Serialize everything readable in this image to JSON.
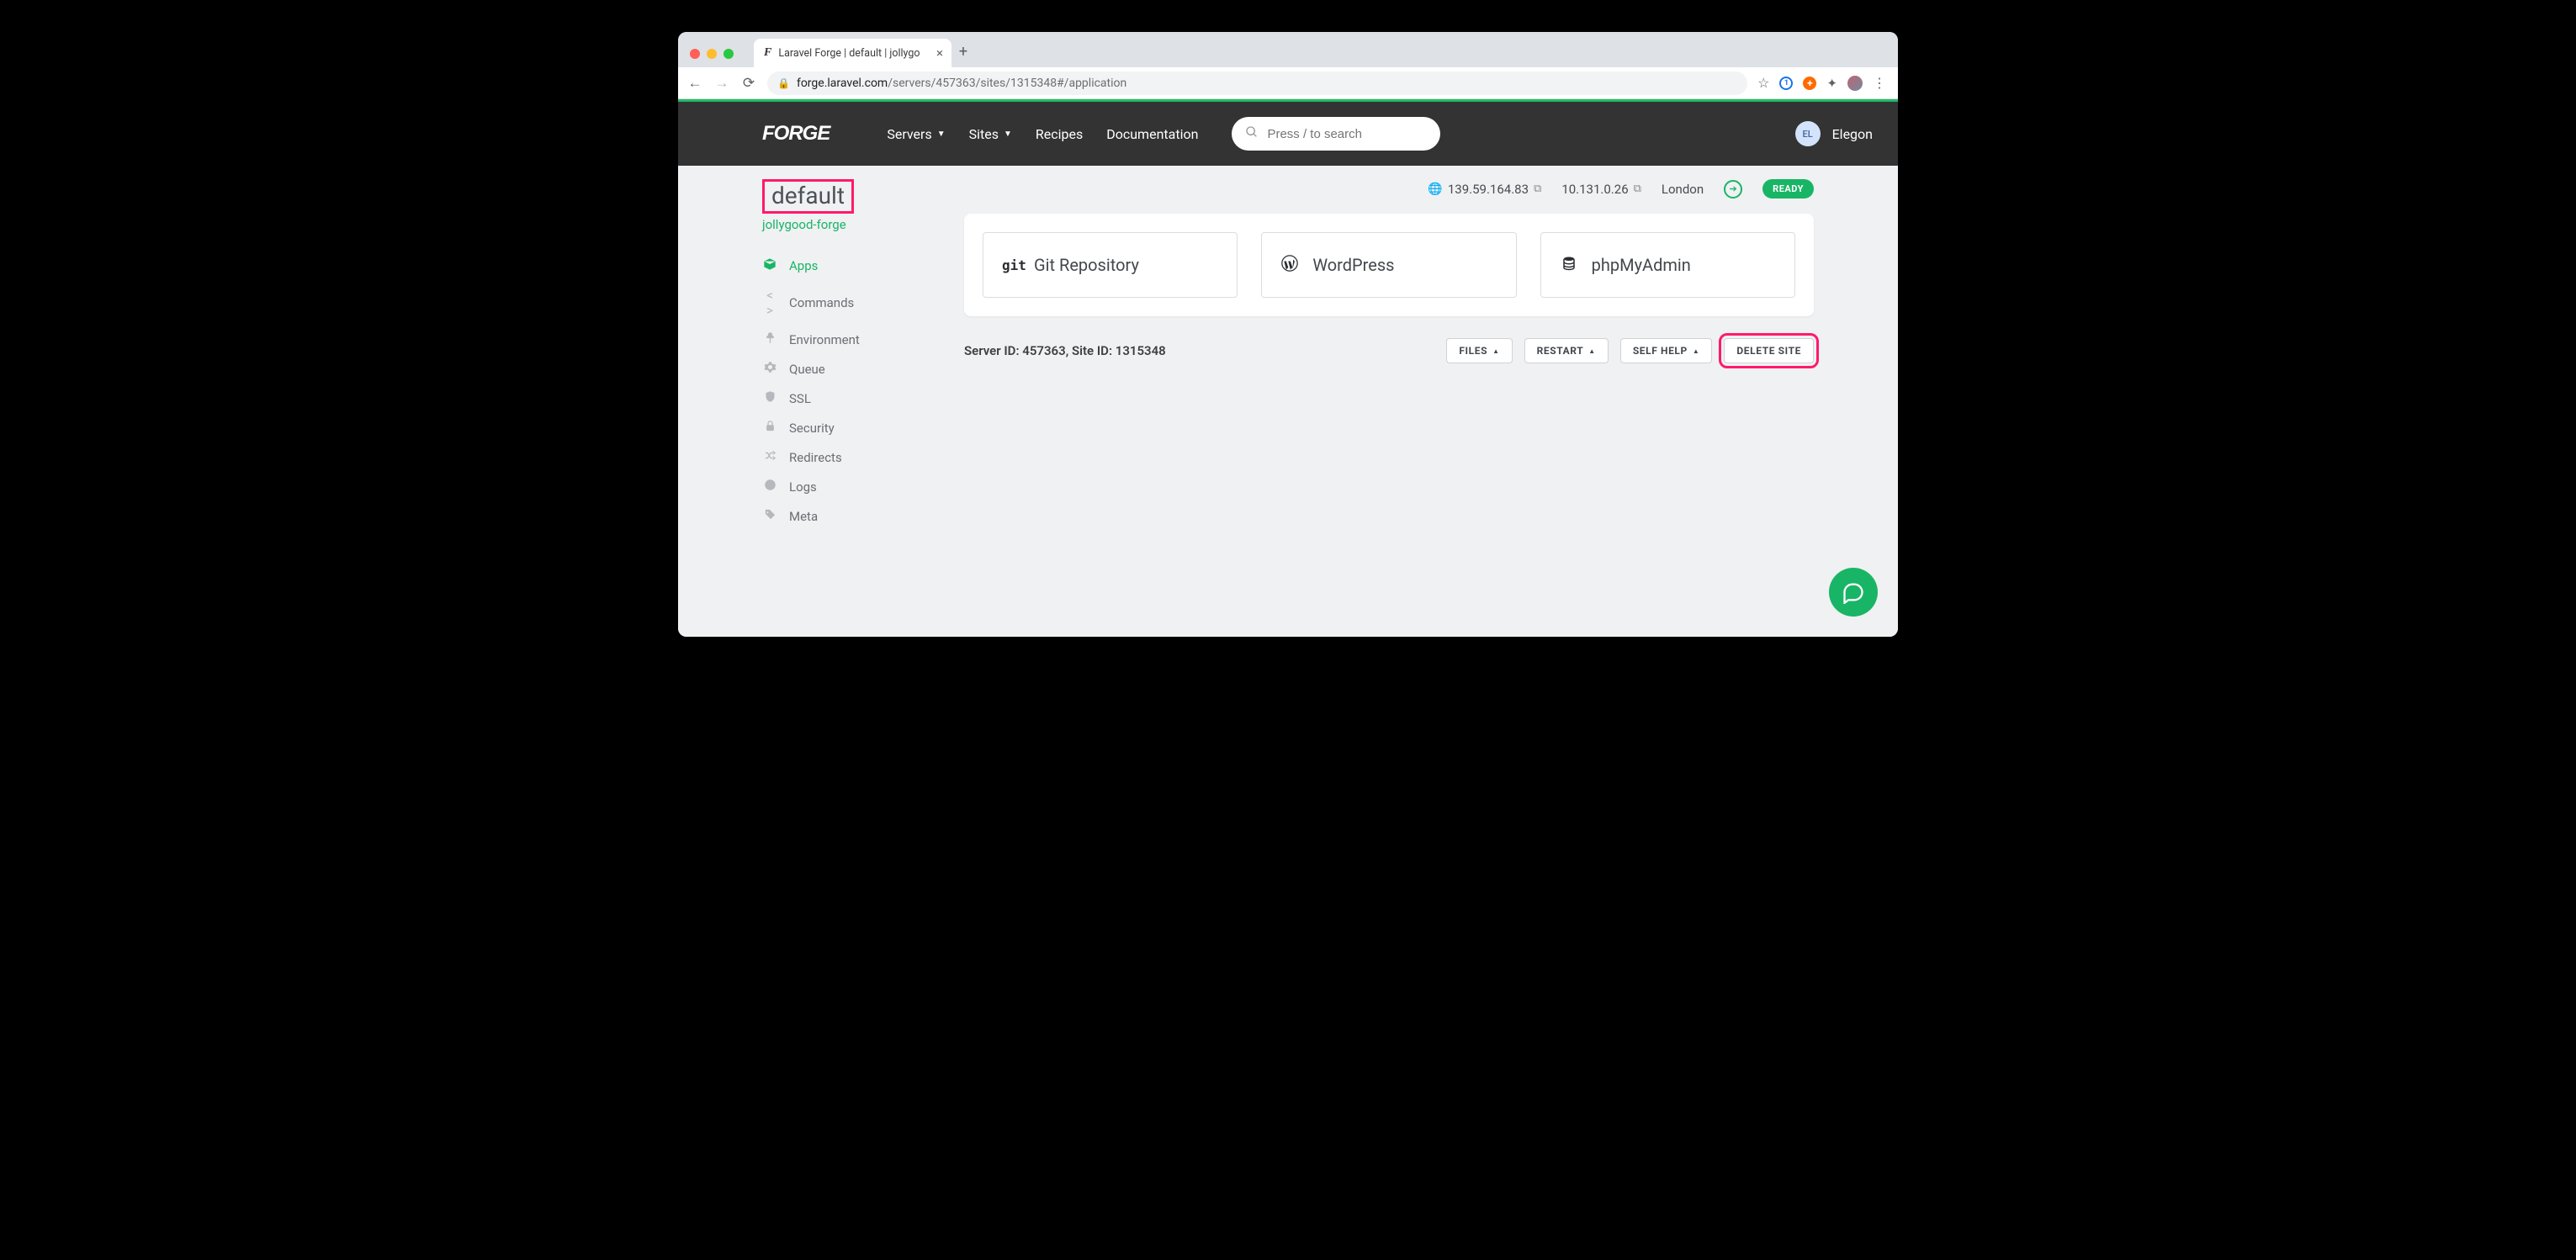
{
  "browser": {
    "tab_title": "Laravel Forge | default | jollygo",
    "url_host": "forge.laravel.com",
    "url_path": "/servers/457363/sites/1315348#/application"
  },
  "header": {
    "logo": "FORGE",
    "nav": {
      "servers": "Servers",
      "sites": "Sites",
      "recipes": "Recipes",
      "documentation": "Documentation"
    },
    "search_placeholder": "Press / to search",
    "user": {
      "initials": "EL",
      "name": "Elegon"
    }
  },
  "page": {
    "title": "default",
    "subtitle": "jollygood-forge",
    "status": {
      "public_ip": "139.59.164.83",
      "private_ip": "10.131.0.26",
      "region": "London",
      "badge": "READY"
    },
    "sidebar": [
      {
        "label": "Apps",
        "active": true
      },
      {
        "label": "Commands"
      },
      {
        "label": "Environment"
      },
      {
        "label": "Queue"
      },
      {
        "label": "SSL"
      },
      {
        "label": "Security"
      },
      {
        "label": "Redirects"
      },
      {
        "label": "Logs"
      },
      {
        "label": "Meta"
      }
    ],
    "cards": {
      "git": "Git Repository",
      "wordpress": "WordPress",
      "phpmyadmin": "phpMyAdmin"
    },
    "ids": {
      "server_label": "Server ID:",
      "server_value": "457363,",
      "site_label": "Site ID:",
      "site_value": "1315348"
    },
    "actions": {
      "files": "FILES",
      "restart": "RESTART",
      "self_help": "SELF HELP",
      "delete": "DELETE SITE"
    }
  }
}
